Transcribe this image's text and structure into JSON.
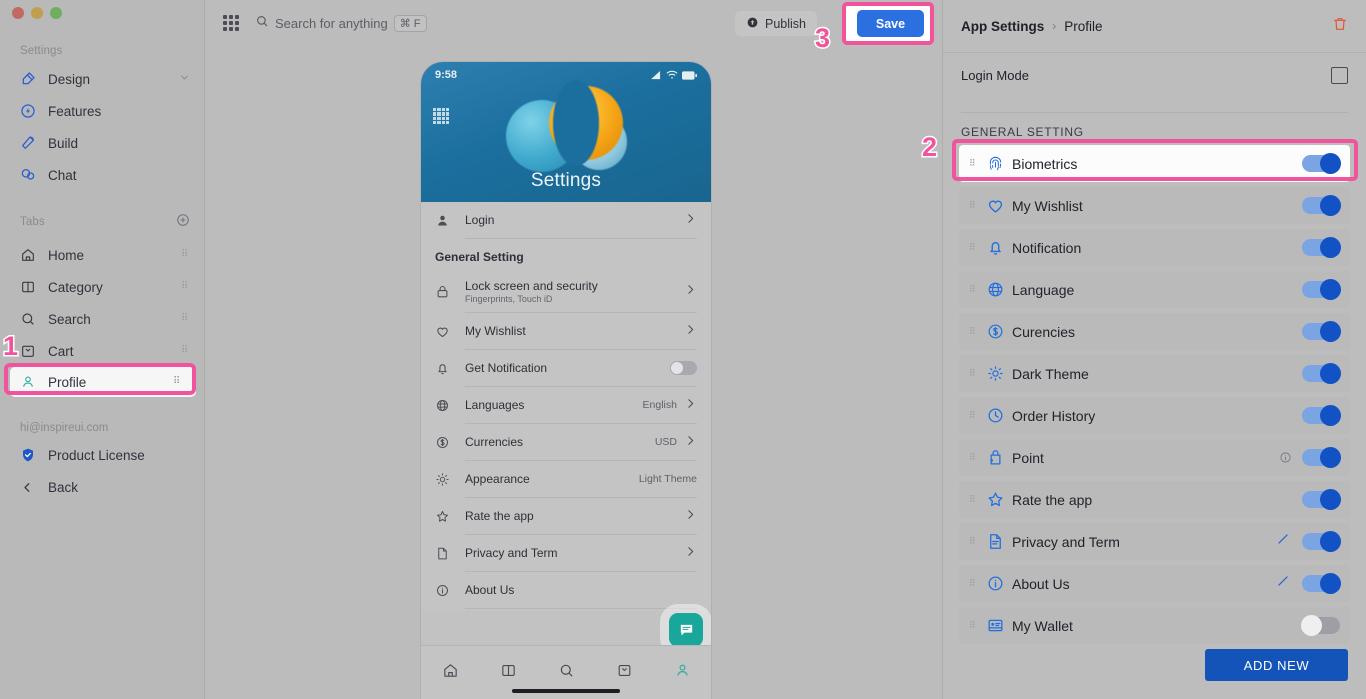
{
  "window": {
    "traffic_lights": [
      "close",
      "minimize",
      "zoom"
    ]
  },
  "sidebar": {
    "settings_label": "Settings",
    "settings_items": [
      {
        "label": "Design",
        "icon": "design-icon",
        "trailing": "chevron-down"
      },
      {
        "label": "Features",
        "icon": "features-icon",
        "trailing": ""
      },
      {
        "label": "Build",
        "icon": "build-icon",
        "trailing": ""
      },
      {
        "label": "Chat",
        "icon": "chat-icon",
        "trailing": ""
      }
    ],
    "tabs_label": "Tabs",
    "tabs_add_icon": "plus-circle-icon",
    "tabs_items": [
      {
        "label": "Home",
        "icon": "home-icon"
      },
      {
        "label": "Category",
        "icon": "category-icon"
      },
      {
        "label": "Search",
        "icon": "search-icon"
      },
      {
        "label": "Cart",
        "icon": "cart-icon"
      },
      {
        "label": "Profile",
        "icon": "profile-icon"
      }
    ],
    "account_email": "hi@inspireui.com",
    "product_license": "Product License",
    "back": "Back"
  },
  "topbar": {
    "apps_icon": "grid-apps-icon",
    "search_placeholder": "Search for anything",
    "search_shortcut": "⌘ F",
    "publish_label": "Publish",
    "save_label": "Save"
  },
  "phone": {
    "status_time": "9:58",
    "hero_title": "Settings",
    "login_row": {
      "label": "Login",
      "icon": "person-icon"
    },
    "group_title": "General Setting",
    "rows": [
      {
        "label": "Lock screen and security",
        "sub": "Fingerprints, Touch iD",
        "icon": "lock-icon",
        "value": "",
        "control": "chevron"
      },
      {
        "label": "My Wishlist",
        "sub": "",
        "icon": "heart-icon",
        "value": "",
        "control": "chevron"
      },
      {
        "label": "Get Notification",
        "sub": "",
        "icon": "bell-icon",
        "value": "",
        "control": "switch-off"
      },
      {
        "label": "Languages",
        "sub": "",
        "icon": "globe-icon",
        "value": "English",
        "control": "chevron"
      },
      {
        "label": "Currencies",
        "sub": "",
        "icon": "dollar-icon",
        "value": "USD",
        "control": "chevron"
      },
      {
        "label": "Appearance",
        "sub": "",
        "icon": "sun-icon",
        "value": "Light Theme",
        "control": "none"
      },
      {
        "label": "Rate the app",
        "sub": "",
        "icon": "star-icon",
        "value": "",
        "control": "chevron"
      },
      {
        "label": "Privacy and Term",
        "sub": "",
        "icon": "document-icon",
        "value": "",
        "control": "chevron"
      },
      {
        "label": "About Us",
        "sub": "",
        "icon": "info-circle-icon",
        "value": "",
        "control": "none"
      }
    ],
    "fab_icon": "chat-bubble-icon",
    "bottom_nav": [
      "home-icon",
      "category-icon",
      "search-icon",
      "bag-icon",
      "profile-icon"
    ]
  },
  "right_panel": {
    "breadcrumb_root": "App Settings",
    "breadcrumb_sep": "›",
    "breadcrumb_current": "Profile",
    "delete_icon": "trash-icon",
    "login_mode_label": "Login Mode",
    "login_mode_checked": false,
    "group_title": "GENERAL SETTING",
    "items": [
      {
        "label": "Biometrics",
        "icon": "fingerprint-icon",
        "toggle": "on",
        "edit": false,
        "info": false,
        "highlighted": true
      },
      {
        "label": "My Wishlist",
        "icon": "heart-icon",
        "toggle": "on",
        "edit": false,
        "info": false,
        "highlighted": false
      },
      {
        "label": "Notification",
        "icon": "bell-icon",
        "toggle": "on",
        "edit": false,
        "info": false,
        "highlighted": false
      },
      {
        "label": "Language",
        "icon": "globe-icon",
        "toggle": "on",
        "edit": false,
        "info": false,
        "highlighted": false
      },
      {
        "label": "Curencies",
        "icon": "dollar-icon",
        "toggle": "on",
        "edit": false,
        "info": false,
        "highlighted": false
      },
      {
        "label": "Dark Theme",
        "icon": "sun-icon",
        "toggle": "on",
        "edit": false,
        "info": false,
        "highlighted": false
      },
      {
        "label": "Order History",
        "icon": "clock-icon",
        "toggle": "on",
        "edit": false,
        "info": false,
        "highlighted": false
      },
      {
        "label": "Point",
        "icon": "point-bag-icon",
        "toggle": "on",
        "edit": false,
        "info": true,
        "highlighted": false
      },
      {
        "label": "Rate the app",
        "icon": "star-icon",
        "toggle": "on",
        "edit": false,
        "info": false,
        "highlighted": false
      },
      {
        "label": "Privacy and Term",
        "icon": "document-icon",
        "toggle": "on",
        "edit": true,
        "info": false,
        "highlighted": false
      },
      {
        "label": "About Us",
        "icon": "info-circle-icon",
        "toggle": "on",
        "edit": true,
        "info": false,
        "highlighted": false
      },
      {
        "label": "My Wallet",
        "icon": "wallet-icon",
        "toggle": "off",
        "edit": false,
        "info": false,
        "highlighted": false
      }
    ],
    "add_new_label": "ADD NEW"
  },
  "steps": [
    {
      "number": "1",
      "target": "sidebar-item-profile"
    },
    {
      "number": "2",
      "target": "right-panel-row-biometrics"
    },
    {
      "number": "3",
      "target": "save-button"
    }
  ],
  "colors": {
    "accent_pink": "#f2539d",
    "brand_blue": "#1565d8",
    "save_blue": "#2c6fe0",
    "add_new_blue": "#1454b8",
    "teal_fab": "#1aa79b",
    "trash_red": "#e2543c"
  }
}
